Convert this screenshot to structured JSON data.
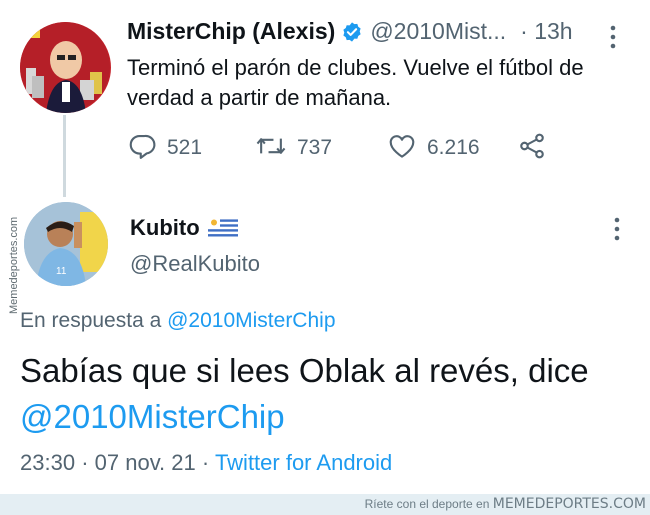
{
  "parent_tweet": {
    "display_name": "MisterChip (Alexis)",
    "handle": "@2010Mist...",
    "time": "· 13h",
    "text": "Terminó el parón de clubes. Vuelve el fútbol de verdad a partir de mañana.",
    "replies": "521",
    "retweets": "737",
    "likes": "6.216",
    "verified": true
  },
  "reply_tweet": {
    "display_name": "Kubito",
    "flag_icon": "uruguay-flag-icon",
    "handle": "@RealKubito",
    "reply_prefix": "En respuesta a",
    "reply_to": "@2010MisterChip",
    "text": "Sabías que si lees Oblak al revés, dice",
    "mention": "@2010MisterChip",
    "time": "23:30",
    "date": "07 nov. 21",
    "source": "Twitter for Android"
  },
  "watermark": {
    "side": "Memedeportes.com",
    "footer_prefix": "Ríete con el deporte en",
    "footer_brand": "MEMEDEPORTES.COM"
  },
  "colors": {
    "link": "#1d9bf0",
    "secondary_text": "#536471",
    "verified": "#1d9bf0",
    "thread_line": "#cfd9de",
    "footer_bg": "#e4eef3"
  }
}
